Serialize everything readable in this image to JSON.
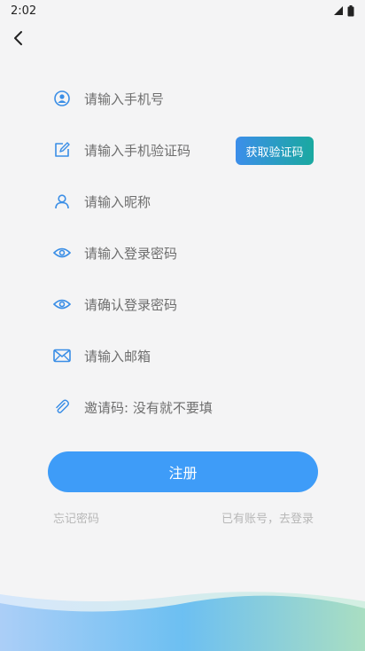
{
  "status": {
    "time": "2:02"
  },
  "form": {
    "phone_placeholder": "请输入手机号",
    "code_placeholder": "请输入手机验证码",
    "get_code_label": "获取验证码",
    "nickname_placeholder": "请输入昵称",
    "password_placeholder": "请输入登录密码",
    "confirm_password_placeholder": "请确认登录密码",
    "email_placeholder": "请输入邮箱",
    "invite_placeholder": "邀请码: 没有就不要填"
  },
  "actions": {
    "register_label": "注册",
    "forgot_label": "忘记密码",
    "login_label": "已有账号，去登录"
  },
  "icons": {
    "back": "back-arrow-icon",
    "phone": "user-circle-icon",
    "code": "edit-icon",
    "nickname": "person-icon",
    "password": "eye-icon",
    "confirm": "eye-icon",
    "email": "mail-icon",
    "invite": "paperclip-icon"
  },
  "colors": {
    "accent": "#3e9cf8",
    "icon": "#3a8ee6",
    "gradient_start": "#3c8eea",
    "gradient_end": "#1aa9a0",
    "background": "#f4f4f5"
  }
}
